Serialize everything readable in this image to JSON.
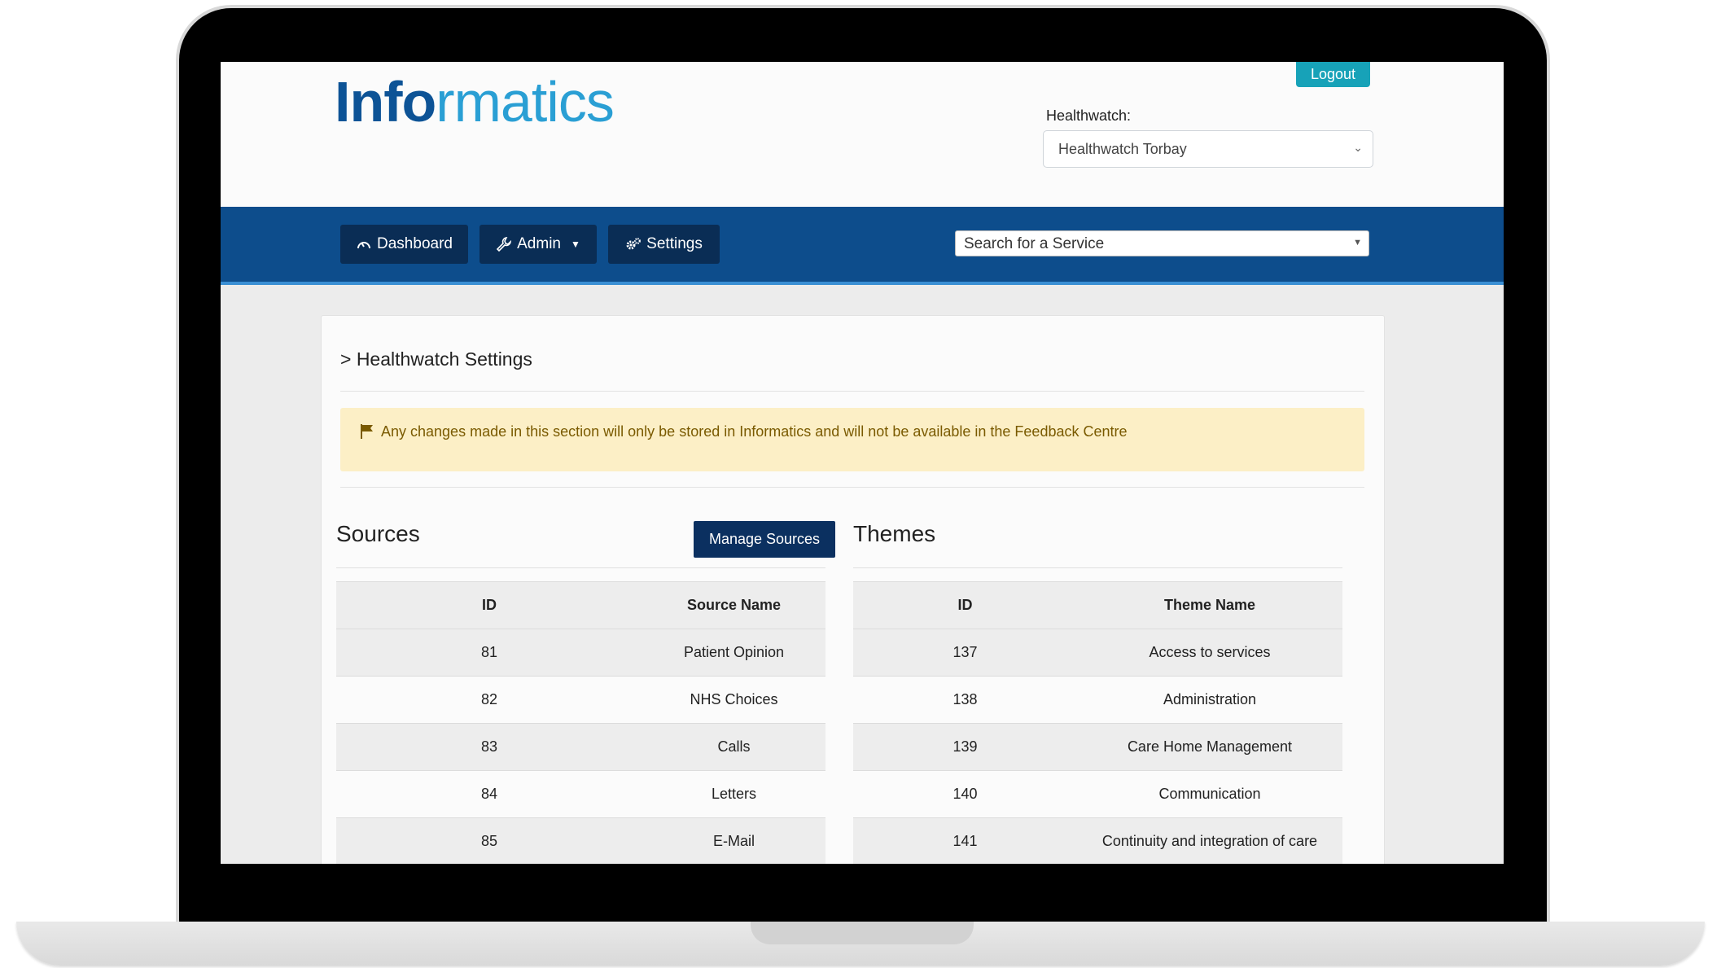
{
  "header": {
    "logo_part1": "Info",
    "logo_part2": "rmatics",
    "logout_label": "Logout",
    "healthwatch_label": "Healthwatch:",
    "healthwatch_selected": "Healthwatch Torbay"
  },
  "nav": {
    "dashboard_label": "Dashboard",
    "admin_label": "Admin",
    "settings_label": "Settings",
    "search_placeholder": "Search for a Service"
  },
  "page": {
    "title": "> Healthwatch Settings",
    "alert": "Any changes made in this section will only be stored in Informatics and will not be available in the Feedback Centre"
  },
  "sources": {
    "title": "Sources",
    "manage_label": "Manage Sources",
    "columns": [
      "ID",
      "Source Name"
    ],
    "rows": [
      [
        "81",
        "Patient Opinion"
      ],
      [
        "82",
        "NHS Choices"
      ],
      [
        "83",
        "Calls"
      ],
      [
        "84",
        "Letters"
      ],
      [
        "85",
        "E-Mail"
      ]
    ]
  },
  "themes": {
    "title": "Themes",
    "columns": [
      "ID",
      "Theme Name"
    ],
    "rows": [
      [
        "137",
        "Access to services"
      ],
      [
        "138",
        "Administration"
      ],
      [
        "139",
        "Care Home Management"
      ],
      [
        "140",
        "Communication"
      ],
      [
        "141",
        "Continuity and integration of care"
      ]
    ]
  },
  "colors": {
    "brand_dark": "#0d5396",
    "brand_light": "#2a9fd4",
    "navbar": "#0d4d8c",
    "logout": "#17a2b8",
    "alert_bg": "#fcefc6"
  }
}
